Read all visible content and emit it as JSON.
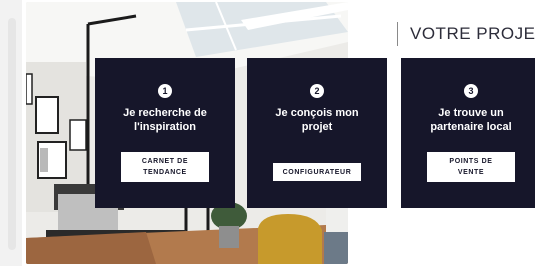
{
  "section": {
    "heading": "VOTRE PROJET"
  },
  "steps": [
    {
      "number": "1",
      "title": "Je recherche de\nl'inspiration",
      "button": "CARNET DE\nTENDANCE"
    },
    {
      "number": "2",
      "title": "Je conçois mon\nprojet",
      "button": "CONFIGURATEUR"
    },
    {
      "number": "3",
      "title": "Je trouve un\npartenaire local",
      "button": "POINTS DE\nVENTE"
    }
  ],
  "colors": {
    "card_background": "#16162a",
    "button_background": "#ffffff",
    "heading_text": "#2d2d3a"
  }
}
